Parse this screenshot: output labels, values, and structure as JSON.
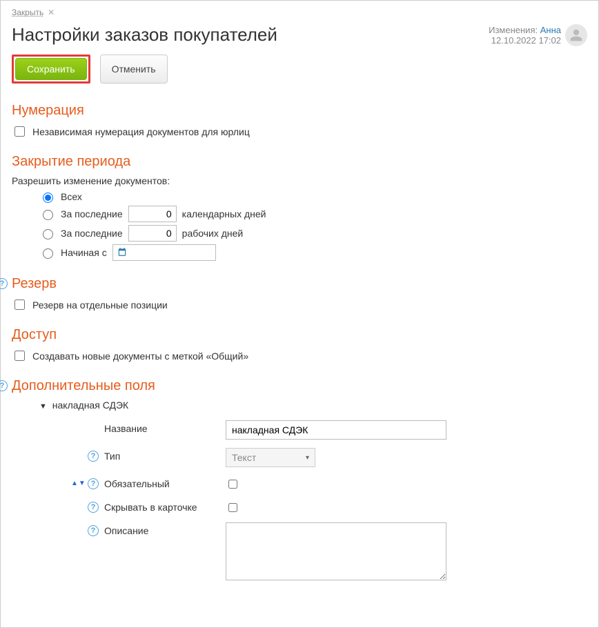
{
  "close": {
    "label": "Закрыть"
  },
  "title": "Настройки заказов покупателей",
  "meta": {
    "changes_label": "Изменения:",
    "user": "Анна",
    "timestamp": "12.10.2022 17:02"
  },
  "buttons": {
    "save": "Сохранить",
    "cancel": "Отменить"
  },
  "sections": {
    "numbering": {
      "title": "Нумерация",
      "checkbox": "Независимая нумерация документов для юрлиц"
    },
    "period": {
      "title": "Закрытие периода",
      "sub": "Разрешить изменение документов:",
      "radios": {
        "all": "Всех",
        "last_cal_prefix": "За последние",
        "last_cal_value": "0",
        "last_cal_suffix": "календарных дней",
        "last_work_prefix": "За последние",
        "last_work_value": "0",
        "last_work_suffix": "рабочих дней",
        "from_prefix": "Начиная с"
      }
    },
    "reserve": {
      "title": "Резерв",
      "checkbox": "Резерв на отдельные позиции"
    },
    "access": {
      "title": "Доступ",
      "checkbox": "Создавать новые документы с меткой «Общий»"
    },
    "extra": {
      "title": "Дополнительные поля",
      "group": "накладная СДЭК",
      "fields": {
        "name_label": "Название",
        "name_value": "накладная СДЭК",
        "type_label": "Тип",
        "type_value": "Текст",
        "required_label": "Обязательный",
        "hide_label": "Скрывать в карточке",
        "desc_label": "Описание"
      }
    }
  }
}
